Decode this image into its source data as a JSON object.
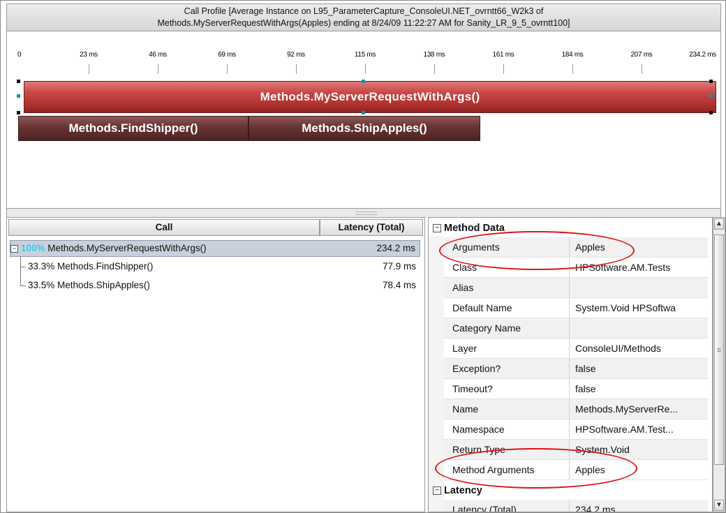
{
  "title": {
    "line1": "Call Profile [Average Instance on L95_ParameterCapture_ConsoleUI.NET_ovrntt66_W2k3 of",
    "line2": "Methods.MyServerRequestWithArgs(Apples) ending at 8/24/09 11:22:27 AM for Sanity_LR_9_5_ovrntt100]"
  },
  "timeline": {
    "ticks": [
      "0",
      "23 ms",
      "46 ms",
      "69 ms",
      "92 ms",
      "115 ms",
      "138 ms",
      "161 ms",
      "184 ms",
      "207 ms",
      "234.2 ms"
    ],
    "main_bar": "Methods.MyServerRequestWithArgs()",
    "child_bars": [
      "Methods.FindShipper()",
      "Methods.ShipApples()"
    ]
  },
  "call_tree": {
    "col_call": "Call",
    "col_latency": "Latency (Total)",
    "rows": [
      {
        "expander": "−",
        "pct": "100%",
        "name": "Methods.MyServerRequestWithArgs()",
        "latency": "234.2 ms"
      },
      {
        "pct": "33.3%",
        "name": "Methods.FindShipper()",
        "latency": "77.9 ms"
      },
      {
        "pct": "33.5%",
        "name": "Methods.ShipApples()",
        "latency": "78.4 ms"
      }
    ]
  },
  "properties": {
    "section_method": "Method Data",
    "section_latency": "Latency",
    "expander": "−",
    "rows": [
      {
        "name": "Arguments",
        "value": "Apples"
      },
      {
        "name": "Class",
        "value": "HPSoftware.AM.Tests"
      },
      {
        "name": "Alias",
        "value": ""
      },
      {
        "name": "Default Name",
        "value": "System.Void HPSoftwa"
      },
      {
        "name": "Category Name",
        "value": ""
      },
      {
        "name": "Layer",
        "value": "ConsoleUI/Methods"
      },
      {
        "name": "Exception?",
        "value": "false"
      },
      {
        "name": "Timeout?",
        "value": "false"
      },
      {
        "name": "Name",
        "value": "Methods.MyServerRe..."
      },
      {
        "name": "Namespace",
        "value": "HPSoftware.AM.Test..."
      },
      {
        "name": "Return Type",
        "value": "System.Void"
      },
      {
        "name": "Method Arguments",
        "value": "Apples"
      }
    ],
    "latency_rows": [
      {
        "name": "Latency (Total)",
        "value": "234.2 ms"
      }
    ]
  },
  "scrollbar": {
    "up": "▲",
    "down": "▼",
    "grip": "≡"
  },
  "colors": {
    "main_bar": "#c94845",
    "child_bar": "#6a3636",
    "highlight_oval": "#e01313",
    "pct_highlight": "#27d3f0"
  }
}
